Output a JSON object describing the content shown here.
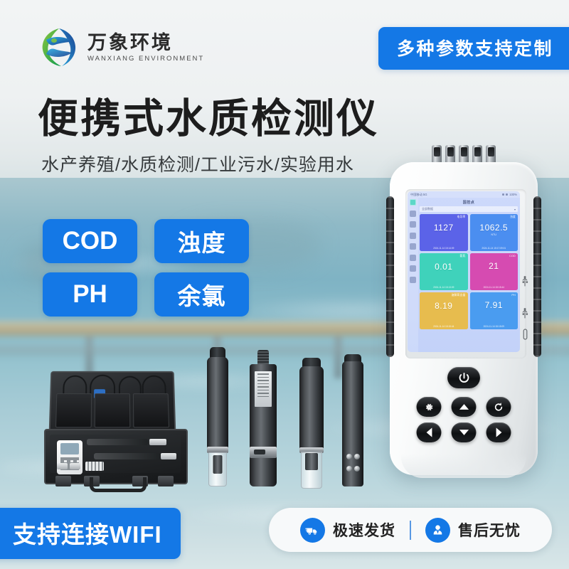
{
  "brand": {
    "name_cn": "万象环境",
    "name_en": "WANXIANG ENVIRONMENT",
    "logo_icon": "globe-swirl-logo",
    "colors": {
      "blue": "#1478e6",
      "green": "#7cc142",
      "dark_blue": "#1b3f8f"
    }
  },
  "badges": {
    "custom": "多种参数支持定制"
  },
  "hero": {
    "title": "便携式水质检测仪",
    "subtitle": "水产养殖/水质检测/工业污水/实验用水"
  },
  "param_tags": [
    {
      "label": "COD",
      "script": "latin"
    },
    {
      "label": "浊度",
      "script": "cjk"
    },
    {
      "label": "PH",
      "script": "latin"
    },
    {
      "label": "余氯",
      "script": "cjk"
    }
  ],
  "wifi_banner": {
    "label": "支持连接WIFI"
  },
  "service": {
    "items": [
      {
        "icon": "delivery-truck-icon",
        "label": "极速发货"
      },
      {
        "icon": "customer-service-person-icon",
        "label": "售后无忧"
      }
    ]
  },
  "device": {
    "ports_count": 5,
    "side_icons": [
      "usb-icon",
      "usb-icon",
      "port-icon"
    ],
    "buttons": [
      {
        "name": "power-button",
        "icon": "power-icon"
      },
      {
        "name": "settings-button",
        "icon": "gear-icon"
      },
      {
        "name": "up-button",
        "icon": "arrow-up-icon"
      },
      {
        "name": "refresh-button",
        "icon": "refresh-icon"
      },
      {
        "name": "left-button",
        "icon": "arrow-left-icon"
      },
      {
        "name": "down-button",
        "icon": "arrow-down-icon"
      },
      {
        "name": "right-button",
        "icon": "arrow-right-icon"
      }
    ],
    "screen": {
      "status_left": "中国移动 5G",
      "status_right": "100%",
      "title": "国控点",
      "selector_value": "全部数据",
      "sidebar_icons": [
        "home-icon",
        "chart-icon",
        "list-icon",
        "cloud-icon",
        "edit-icon",
        "settings-icon",
        "user-icon",
        "tools-icon"
      ],
      "cards": [
        {
          "name": "电导率",
          "value": "1127",
          "unit": "",
          "time": "2024-11-14 15:14:09",
          "color": "#5b63e8"
        },
        {
          "name": "浊度",
          "value": "1062.5",
          "unit": "NTU",
          "time": "2024-11-14 15:17:09:01",
          "color": "#4b8ef0"
        },
        {
          "name": "氨氮",
          "value": "0.01",
          "unit": "",
          "time": "2024-11-14 15:13:09",
          "color": "#3fd2bb"
        },
        {
          "name": "COD",
          "value": "21",
          "unit": "",
          "time": "2024-11-14 15:15:44",
          "color": "#d64bb1"
        },
        {
          "name": "溶解氧含量",
          "value": "8.19",
          "unit": "",
          "time": "2024-11-14 15:15:44",
          "color": "#e7bc4e"
        },
        {
          "name": "PH",
          "value": "7.91",
          "unit": "",
          "time": "2024-11-14 15:15:09",
          "color": "#4a9cf0"
        }
      ]
    }
  },
  "products": {
    "case": {
      "name": "portable-hard-case"
    },
    "probes": [
      {
        "name": "conductivity-probe"
      },
      {
        "name": "labeled-sensor-probe"
      },
      {
        "name": "turbidity-probe"
      },
      {
        "name": "multi-hole-sensor-probe"
      }
    ]
  }
}
